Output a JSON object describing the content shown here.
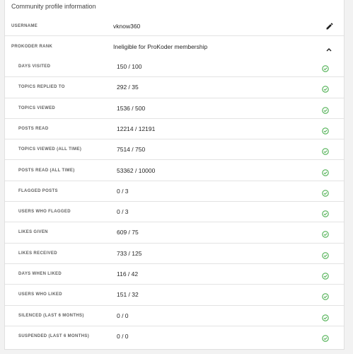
{
  "title": "Community profile information",
  "username": {
    "label": "USERNAME",
    "value": "vknow360"
  },
  "rank": {
    "label": "PROKODER RANK",
    "value": "Ineligible for ProKoder membership"
  },
  "icons": {
    "edit": "pencil-icon",
    "collapse": "chevron-up-icon",
    "check": "check-circle-icon"
  },
  "colors": {
    "check": "#4caf50"
  },
  "stats": [
    {
      "label": "DAYS VISITED",
      "value": "150 / 100"
    },
    {
      "label": "TOPICS REPLIED TO",
      "value": "292 / 35"
    },
    {
      "label": "TOPICS VIEWED",
      "value": "1536 / 500"
    },
    {
      "label": "POSTS READ",
      "value": "12214 / 12191"
    },
    {
      "label": "TOPICS VIEWED (ALL TIME)",
      "value": "7514 / 750"
    },
    {
      "label": "POSTS READ (ALL TIME)",
      "value": "53362 / 10000"
    },
    {
      "label": "FLAGGED POSTS",
      "value": "0 / 3"
    },
    {
      "label": "USERS WHO FLAGGED",
      "value": "0 / 3"
    },
    {
      "label": "LIKES GIVEN",
      "value": "609 / 75"
    },
    {
      "label": "LIKES RECEIVED",
      "value": "733 / 125"
    },
    {
      "label": "DAYS WHEN LIKED",
      "value": "116 / 42"
    },
    {
      "label": "USERS WHO LIKED",
      "value": "151 / 32"
    },
    {
      "label": "SILENCED (LAST 6 MONTHS)",
      "value": "0 / 0"
    },
    {
      "label": "SUSPENDED (LAST 6 MONTHS)",
      "value": "0 / 0"
    }
  ]
}
